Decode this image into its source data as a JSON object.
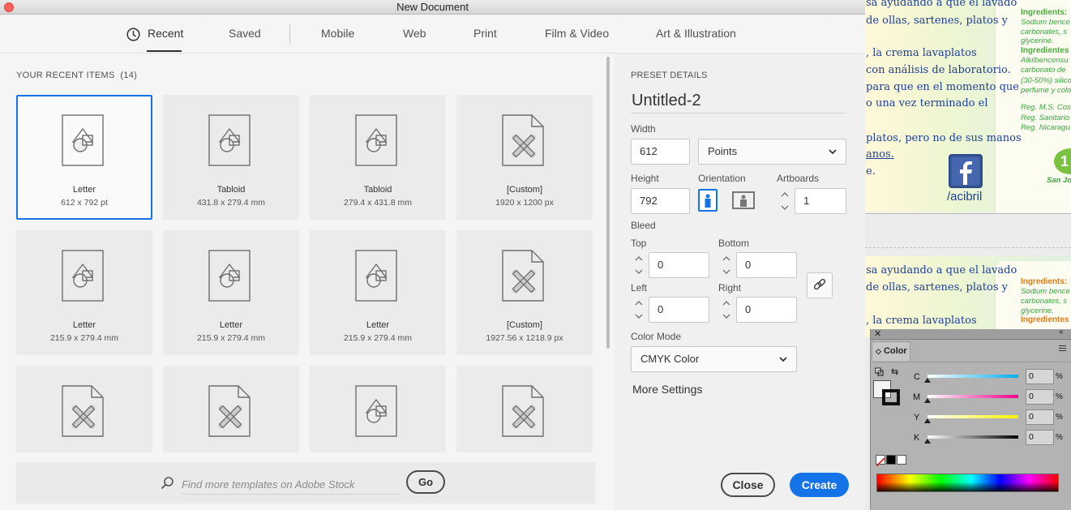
{
  "window": {
    "title": "New Document"
  },
  "tabs": [
    {
      "label": "Recent"
    },
    {
      "label": "Saved"
    },
    {
      "label": "Mobile"
    },
    {
      "label": "Web"
    },
    {
      "label": "Print"
    },
    {
      "label": "Film & Video"
    },
    {
      "label": "Art & Illustration"
    }
  ],
  "recent": {
    "heading": "YOUR RECENT ITEMS",
    "count": "(14)",
    "items": [
      {
        "name": "Letter",
        "size": "612 x 792 pt",
        "icon": "document-shapes-icon"
      },
      {
        "name": "Tabloid",
        "size": "431.8 x 279.4 mm",
        "icon": "document-shapes-icon"
      },
      {
        "name": "Tabloid",
        "size": "279.4 x 431.8 mm",
        "icon": "document-shapes-icon"
      },
      {
        "name": "[Custom]",
        "size": "1920 x 1200 px",
        "icon": "document-ruler-pencil-icon"
      },
      {
        "name": "Letter",
        "size": "215.9 x 279.4 mm",
        "icon": "document-shapes-icon"
      },
      {
        "name": "Letter",
        "size": "215.9 x 279.4 mm",
        "icon": "document-shapes-icon"
      },
      {
        "name": "Letter",
        "size": "215.9 x 279.4 mm",
        "icon": "document-shapes-icon"
      },
      {
        "name": "[Custom]",
        "size": "1927.56 x 1218.9 px",
        "icon": "document-ruler-pencil-icon"
      },
      {
        "icon": "document-ruler-pencil-icon"
      },
      {
        "icon": "document-ruler-pencil-icon"
      },
      {
        "icon": "document-shapes-icon"
      },
      {
        "icon": "document-ruler-pencil-icon"
      }
    ]
  },
  "search": {
    "placeholder": "Find more templates on Adobe Stock",
    "go_label": "Go"
  },
  "preset": {
    "heading": "PRESET DETAILS",
    "name": "Untitled-2",
    "width_label": "Width",
    "width_value": "612",
    "units": "Points",
    "height_label": "Height",
    "height_value": "792",
    "orientation_label": "Orientation",
    "artboards_label": "Artboards",
    "artboards_value": "1",
    "bleed_label": "Bleed",
    "top_label": "Top",
    "top_value": "0",
    "bottom_label": "Bottom",
    "bottom_value": "0",
    "left_label": "Left",
    "left_value": "0",
    "right_label": "Right",
    "right_value": "0",
    "color_mode_label": "Color Mode",
    "color_mode": "CMYK Color",
    "more_settings": "More Settings"
  },
  "buttons": {
    "close": "Close",
    "create": "Create"
  },
  "background_doc": {
    "lines_top": [
      "sa ayudando a que el lavado",
      "de ollas, sartenes, platos y",
      "",
      ", la crema lavaplatos",
      "con análisis de laboratorio.",
      "para que en el momento que",
      "o una vez terminado el",
      "",
      "platos, pero no de sus manos",
      "anos.",
      "e."
    ],
    "ingredients_head": "Ingredients:",
    "ingredients_lines": [
      "Sodium bence",
      "carbonates, s",
      "glycerine."
    ],
    "ingredientes_head": "Ingredientes",
    "ingredientes_lines": [
      "Alkilbencensu",
      "carbonato de",
      "(30-50%) silico",
      "perfume y colo"
    ],
    "reg_lines": [
      "Reg. M.S. Cost",
      "Reg. Sanitario",
      "Reg. Nicaragu"
    ],
    "social_handle": "/acibril",
    "badge_text": "1",
    "city": "San Jos",
    "lines_bottom": [
      "sa ayudando a que el lavado",
      "de ollas, sartenes, platos y",
      "",
      ", la crema lavaplatos"
    ],
    "ingredients_b_head": "Ingredients:",
    "ingredients_b_lines": [
      "Sodium bence",
      "carbonates, s",
      "glycerine."
    ],
    "ingredientes_b_head": "Ingredientes"
  },
  "color_panel": {
    "title": "Color",
    "channels": [
      {
        "letter": "C",
        "value": "0",
        "unit": "%",
        "from": "#ffffff",
        "to": "#00aeef"
      },
      {
        "letter": "M",
        "value": "0",
        "unit": "%",
        "from": "#ffffff",
        "to": "#ec008c"
      },
      {
        "letter": "Y",
        "value": "0",
        "unit": "%",
        "from": "#ffffff",
        "to": "#fff200"
      },
      {
        "letter": "K",
        "value": "0",
        "unit": "%",
        "from": "#ffffff",
        "to": "#000000"
      }
    ]
  },
  "colors": {
    "accent": "#1473e6",
    "text_blue": "#1d3f9a",
    "text_green": "#3aa640"
  }
}
